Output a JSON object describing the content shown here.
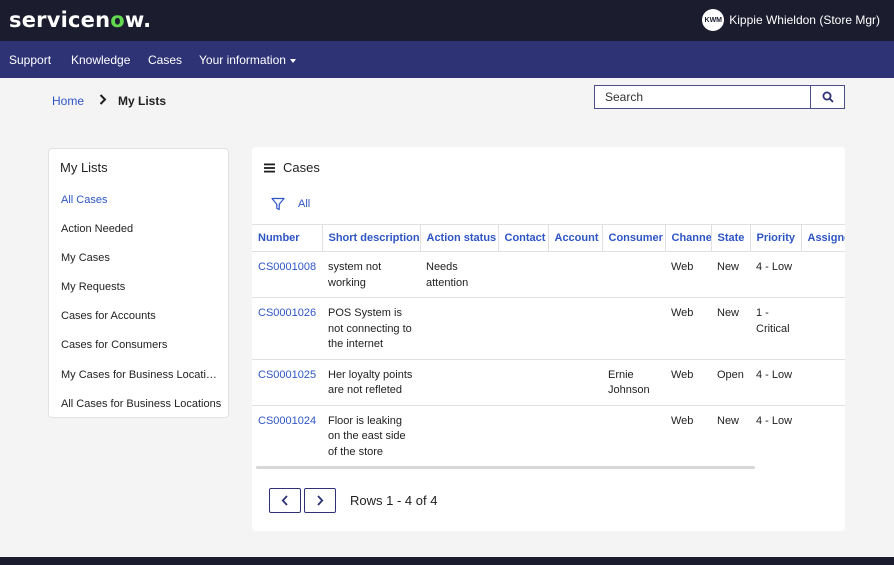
{
  "header": {
    "logo_main": "servicen",
    "logo_o": "o",
    "logo_end": "w.",
    "user_initials": "KWM",
    "user_name": "Kippie Whieldon (Store Mgr)"
  },
  "nav": {
    "items": [
      "Support",
      "Knowledge",
      "Cases",
      "Your information"
    ]
  },
  "breadcrumb": {
    "home": "Home",
    "current": "My Lists"
  },
  "search": {
    "placeholder": "Search"
  },
  "lists": {
    "title": "My Lists",
    "items": [
      "All Cases",
      "Action Needed",
      "My Cases",
      "My Requests",
      "Cases for Accounts",
      "Cases for Consumers",
      "My Cases for Business Locations",
      "All Cases for Business Locations"
    ]
  },
  "cases": {
    "title": "Cases",
    "filter_label": "All",
    "columns": [
      "Number",
      "Short description",
      "Action status",
      "Contact",
      "Account",
      "Consumer",
      "Channel",
      "State",
      "Priority",
      "Assigned to"
    ],
    "rows": [
      [
        "CS0001008",
        "system not working",
        "Needs attention",
        "",
        "",
        "",
        "Web",
        "New",
        "4 - Low",
        ""
      ],
      [
        "CS0001026",
        "POS System is not connecting to the internet",
        "",
        "",
        "",
        "",
        "Web",
        "New",
        "1 - Critical",
        ""
      ],
      [
        "CS0001025",
        "Her loyalty points are not refleted",
        "",
        "",
        "",
        "Ernie Johnson",
        "Web",
        "Open",
        "4 - Low",
        ""
      ],
      [
        "CS0001024",
        "Floor is leaking on the east side of the store",
        "",
        "",
        "",
        "",
        "Web",
        "New",
        "4 - Low",
        ""
      ]
    ],
    "rows_label": "Rows 1 - 4 of 4"
  },
  "colors": {
    "topbar": "#1b1c2e",
    "navbar": "#2e3375",
    "link": "#2e55c4",
    "logo_accent": "#62d84e"
  },
  "icons": [
    "user-avatar",
    "caret-down-icon",
    "chevron-right-icon",
    "search-icon",
    "list-menu-icon",
    "filter-icon",
    "chevron-left-icon"
  ]
}
